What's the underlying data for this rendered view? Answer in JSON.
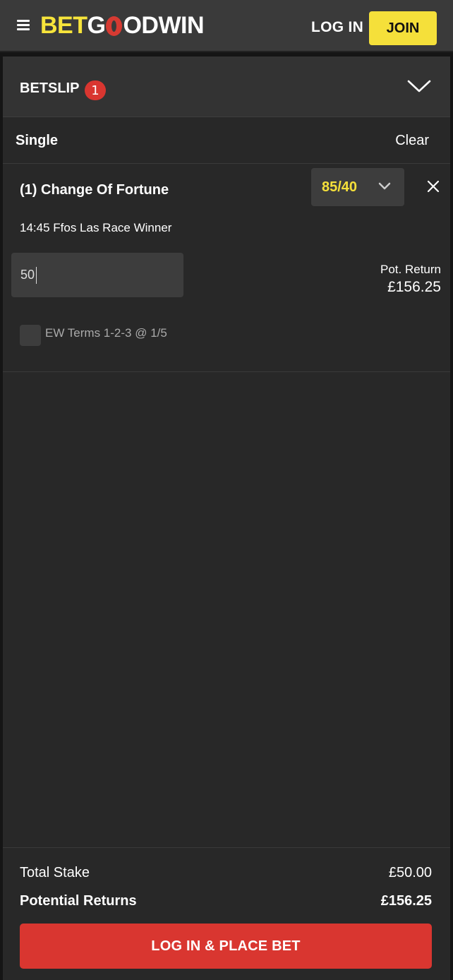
{
  "header": {
    "menu_icon": "hamburger-menu-icon",
    "logo": {
      "part1": "BET",
      "part2": "G",
      "part3": "ODWIN",
      "brand_colors": {
        "yellow": "#f7e43b",
        "red": "#d63a32"
      }
    },
    "login_label": "LOG IN",
    "join_label": "JOIN"
  },
  "betslip": {
    "title": "BETSLIP",
    "count": "1",
    "collapse_icon": "chevron-down-icon",
    "bet_type": "Single",
    "clear_label": "Clear",
    "selection": {
      "name": "(1) Change Of Fortune",
      "odds": "85/40",
      "odds_icon": "chevron-down-icon",
      "remove_icon": "close-icon",
      "market": "14:45 Ffos Las Race Winner",
      "stake_value": "50",
      "pot_return_label": "Pot. Return",
      "pot_return_value": "£156.25",
      "ew_terms": "EW Terms 1-2-3 @ 1/5",
      "ew_checked": false
    },
    "totals": {
      "total_stake_label": "Total Stake",
      "total_stake_value": "£50.00",
      "potential_returns_label": "Potential Returns",
      "potential_returns_value": "£156.25"
    },
    "place_bet_label": "LOG IN & PLACE BET"
  },
  "colors": {
    "accent_yellow": "#f5e03a",
    "accent_red": "#d93630",
    "background": "#282828"
  }
}
